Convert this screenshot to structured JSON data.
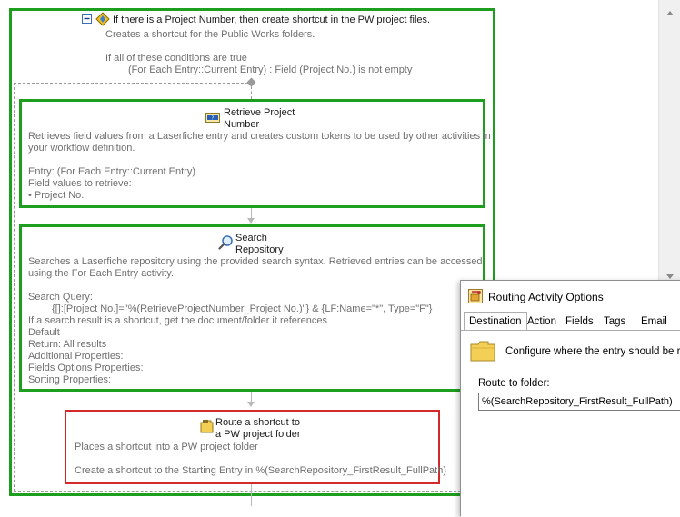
{
  "condition": {
    "title": "If there is a Project Number, then create shortcut in the PW project files.",
    "description": "Creates a shortcut for the Public Works folders.",
    "rule_header": "If all of these conditions are true",
    "rule": "(For Each Entry::Current Entry) : Field (Project No.) is not empty"
  },
  "retrieve": {
    "title_line1": "Retrieve Project",
    "title_line2": "Number",
    "desc_line1": "Retrieves field values from a Laserfiche entry and creates custom tokens to be used by other activities in",
    "desc_line2": "your workflow definition.",
    "entry": "Entry: (For Each Entry::Current Entry)",
    "fields_header": "Field values to retrieve:",
    "field_item": "• Project No."
  },
  "search": {
    "title_line1": "Search",
    "title_line2": "Repository",
    "desc_line1": "Searches a Laserfiche repository using the provided search syntax.  Retrieved entries can be accessed",
    "desc_line2": "using the For Each Entry activity.",
    "query_label": "Search Query:",
    "query": "{[]:[Project No.]=\"%(RetrieveProjectNumber_Project No.)\"} & {LF:Name=\"*\", Type=\"F\"}",
    "shortcut_rule": "If a search result is a shortcut, get the document/folder it references",
    "default": "Default",
    "return": "Return: All results",
    "additional": "Additional Properties:",
    "fields_options": "Fields Options Properties:",
    "sorting": "Sorting Properties:"
  },
  "route": {
    "title_line1": "Route a shortcut to",
    "title_line2": "a PW project folder",
    "desc": "Places a shortcut into a PW project folder",
    "action": "Create a shortcut to the Starting Entry in %(SearchRepository_FirstResult_FullPath)"
  },
  "dialog": {
    "title": "Routing Activity Options",
    "tabs": [
      "Destination",
      "Action",
      "Fields",
      "Tags",
      "Email"
    ],
    "active_tab": "Destination",
    "description": "Configure where the entry should be routed.",
    "route_label": "Route to folder:",
    "route_value": "%(SearchRepository_FirstResult_FullPath)"
  },
  "colors": {
    "selected_border": "#1e9e1e",
    "highlight_border": "#d22a2a"
  }
}
